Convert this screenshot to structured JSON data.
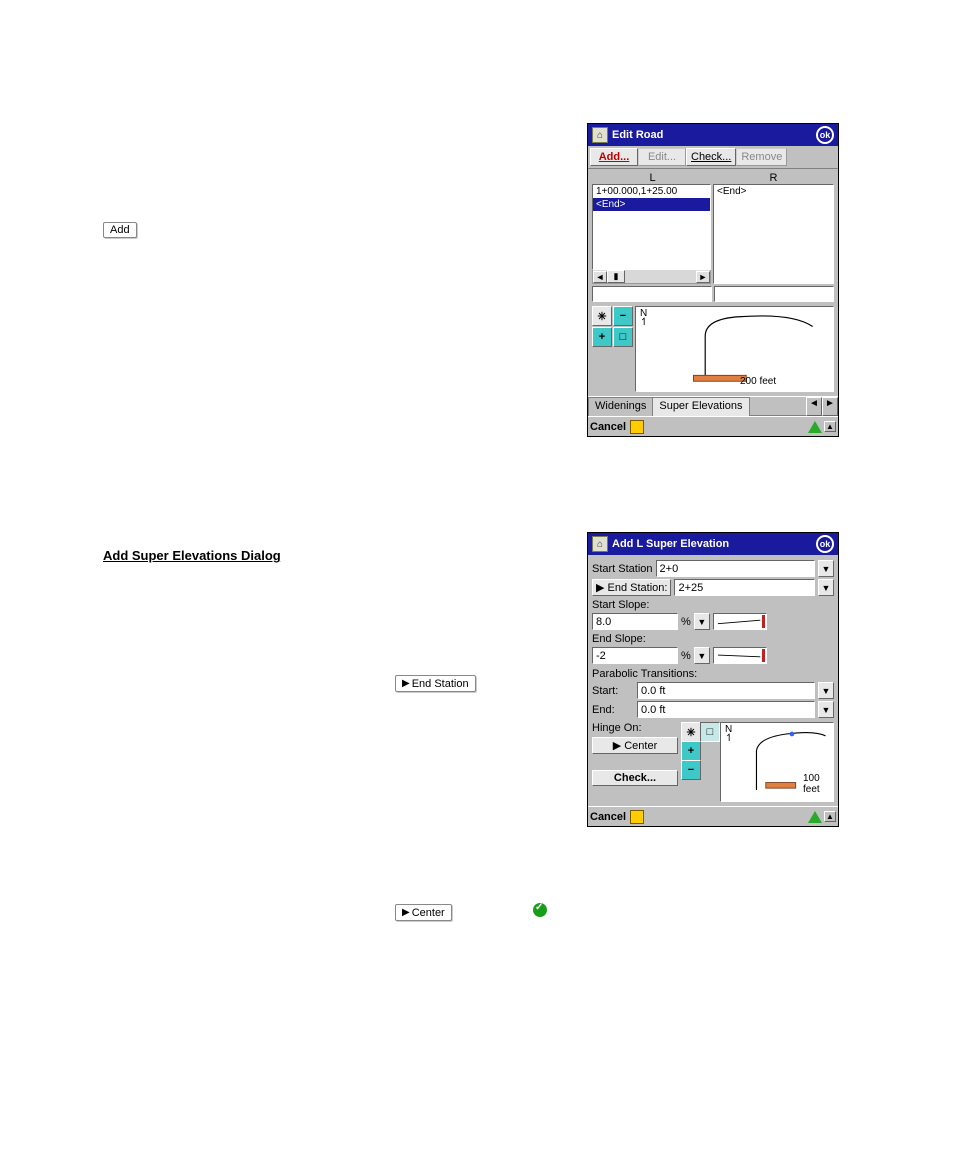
{
  "doc_kbd_add": "Add",
  "doc_heading": "Add Super Elevations Dialog",
  "doc_kbd_end_station": "End Station",
  "doc_kbd_center": "Center",
  "edit_road": {
    "title": "Edit Road",
    "ok": "ok",
    "buttons": {
      "add": "Add...",
      "edit": "Edit...",
      "check": "Check...",
      "remove": "Remove"
    },
    "lr_header": {
      "l": "L",
      "r": "R"
    },
    "left_items": [
      "1+00.000,1+25.00",
      "<End>"
    ],
    "right_items": [
      "<End>"
    ],
    "north_label": "N",
    "scale_label": "200 feet",
    "tabs": {
      "widenings": "Widenings",
      "super": "Super Elevations"
    },
    "cancel": "Cancel"
  },
  "add_se": {
    "title": "Add L Super Elevation",
    "ok": "ok",
    "start_station_label": "Start Station",
    "start_station_value": "2+0",
    "end_station_label": "End Station:",
    "end_station_value": "2+25",
    "start_slope_label": "Start Slope:",
    "start_slope_value": "8.0",
    "end_slope_label": "End Slope:",
    "end_slope_value": "-2",
    "pct": "%",
    "parabolic_label": "Parabolic Transitions:",
    "pt_start_label": "Start:",
    "pt_start_value": "0.0 ft",
    "pt_end_label": "End:",
    "pt_end_value": "0.0 ft",
    "hinge_label": "Hinge On:",
    "hinge_btn": "Center",
    "check_btn": "Check...",
    "north_label": "N",
    "scale_label": "100 feet",
    "cancel": "Cancel"
  }
}
